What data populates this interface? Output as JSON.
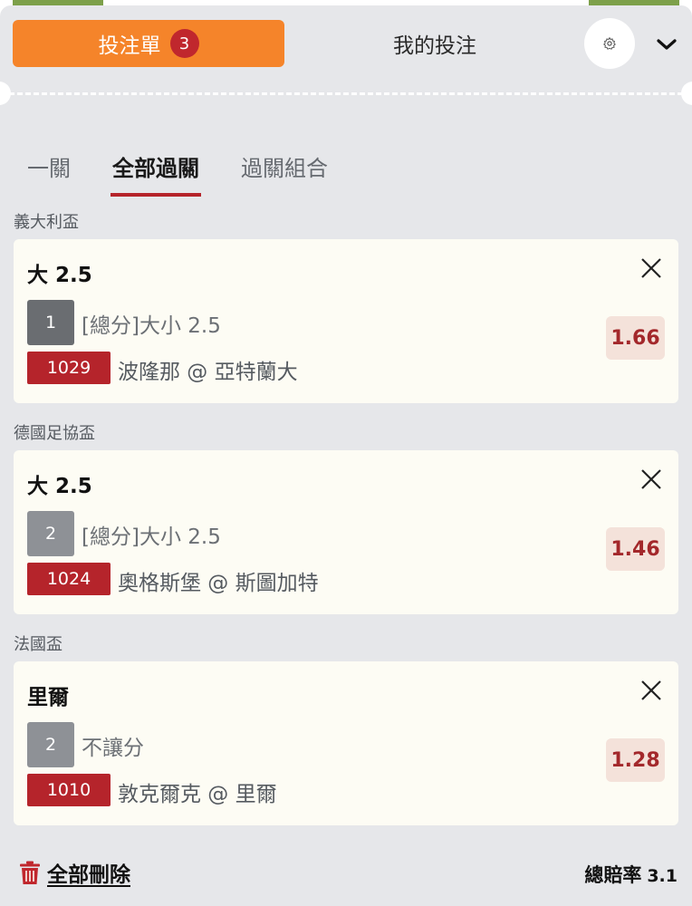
{
  "header": {
    "betslip_label": "投注單",
    "betslip_count": "3",
    "mybets_label": "我的投注"
  },
  "subtabs": [
    "一關",
    "全部過關",
    "過關組合"
  ],
  "active_subtab": "全部過關",
  "bets": [
    {
      "league": "義大利盃",
      "selection": "大 2.5",
      "leg_number": "1",
      "market": "[總分]大小 2.5",
      "match_number": "1029",
      "match": "波隆那 @ 亞特蘭大",
      "odds": "1.66"
    },
    {
      "league": "德國足協盃",
      "selection": "大 2.5",
      "leg_number": "2",
      "market": "[總分]大小 2.5",
      "match_number": "1024",
      "match": "奧格斯堡 @ 斯圖加特",
      "odds": "1.46"
    },
    {
      "league": "法國盃",
      "selection": "里爾",
      "leg_number": "2",
      "market": "不讓分",
      "match_number": "1010",
      "match": "敦克爾克 @ 里爾",
      "odds": "1.28"
    }
  ],
  "footer": {
    "delete_all_label": "全部刪除",
    "total_odds_label": "總賠率",
    "total_odds_value": "3.1"
  },
  "colors": {
    "accent_orange": "#f5842a",
    "accent_red": "#b5242b",
    "odds_bg": "#f4e2da"
  }
}
